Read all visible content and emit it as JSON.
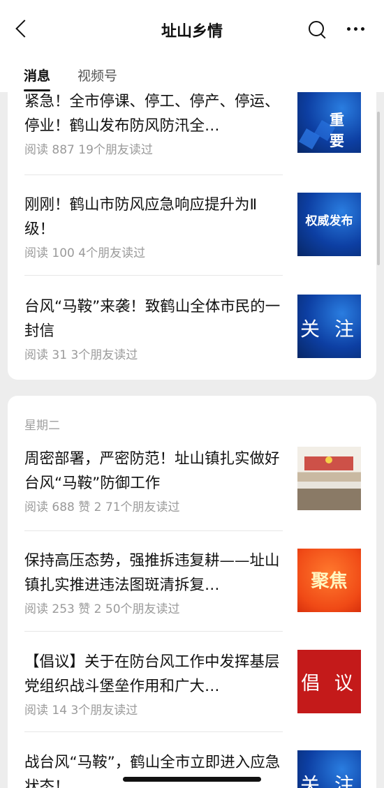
{
  "header": {
    "title": "址山乡情",
    "back_icon": "chevron-left-icon",
    "search_icon": "search-icon",
    "more_icon": "more-dots-icon"
  },
  "tabs": [
    {
      "label": "消息",
      "active": true
    },
    {
      "label": "视频号",
      "active": false
    }
  ],
  "groups": [
    {
      "day_label": "",
      "articles": [
        {
          "title": "紧急！全市停课、停工、停产、停运、停业！鹤山发布防风防汛全…",
          "meta": "阅读 887  19个朋友读过",
          "thumb_text": "重 要"
        },
        {
          "title": "刚刚！鹤山市防风应急响应提升为Ⅱ级！",
          "meta": "阅读 100  4个朋友读过",
          "thumb_text": "权威发布"
        },
        {
          "title": "台风“马鞍”来袭！致鹤山全体市民的一封信",
          "meta": "阅读 31  3个朋友读过",
          "thumb_text": "关 注"
        }
      ]
    },
    {
      "day_label": "星期二",
      "articles": [
        {
          "title": "周密部署，严密防范！址山镇扎实做好台风“马鞍”防御工作",
          "meta": "阅读 688  赞 2  71个朋友读过",
          "thumb_text": ""
        },
        {
          "title": "保持高压态势，强推拆违复耕——址山镇扎实推进违法图斑清拆复…",
          "meta": "阅读 253  赞 2  50个朋友读过",
          "thumb_text": "聚焦"
        },
        {
          "title": "【倡议】关于在防台风工作中发挥基层党组织战斗堡垒作用和广大…",
          "meta": "阅读 14  3个朋友读过",
          "thumb_text": "倡 议"
        },
        {
          "title": "战台风“马鞍”，鹤山全市立即进入应急状态！",
          "meta": "",
          "thumb_text": "关 注"
        }
      ]
    }
  ],
  "colors": {
    "background": "#ededed",
    "card": "#ffffff",
    "meta_text": "#9a9a9a",
    "thumb_blue": "#0d3fa3",
    "thumb_red": "#f04a16",
    "thumb_dark_red": "#c41a1a"
  }
}
